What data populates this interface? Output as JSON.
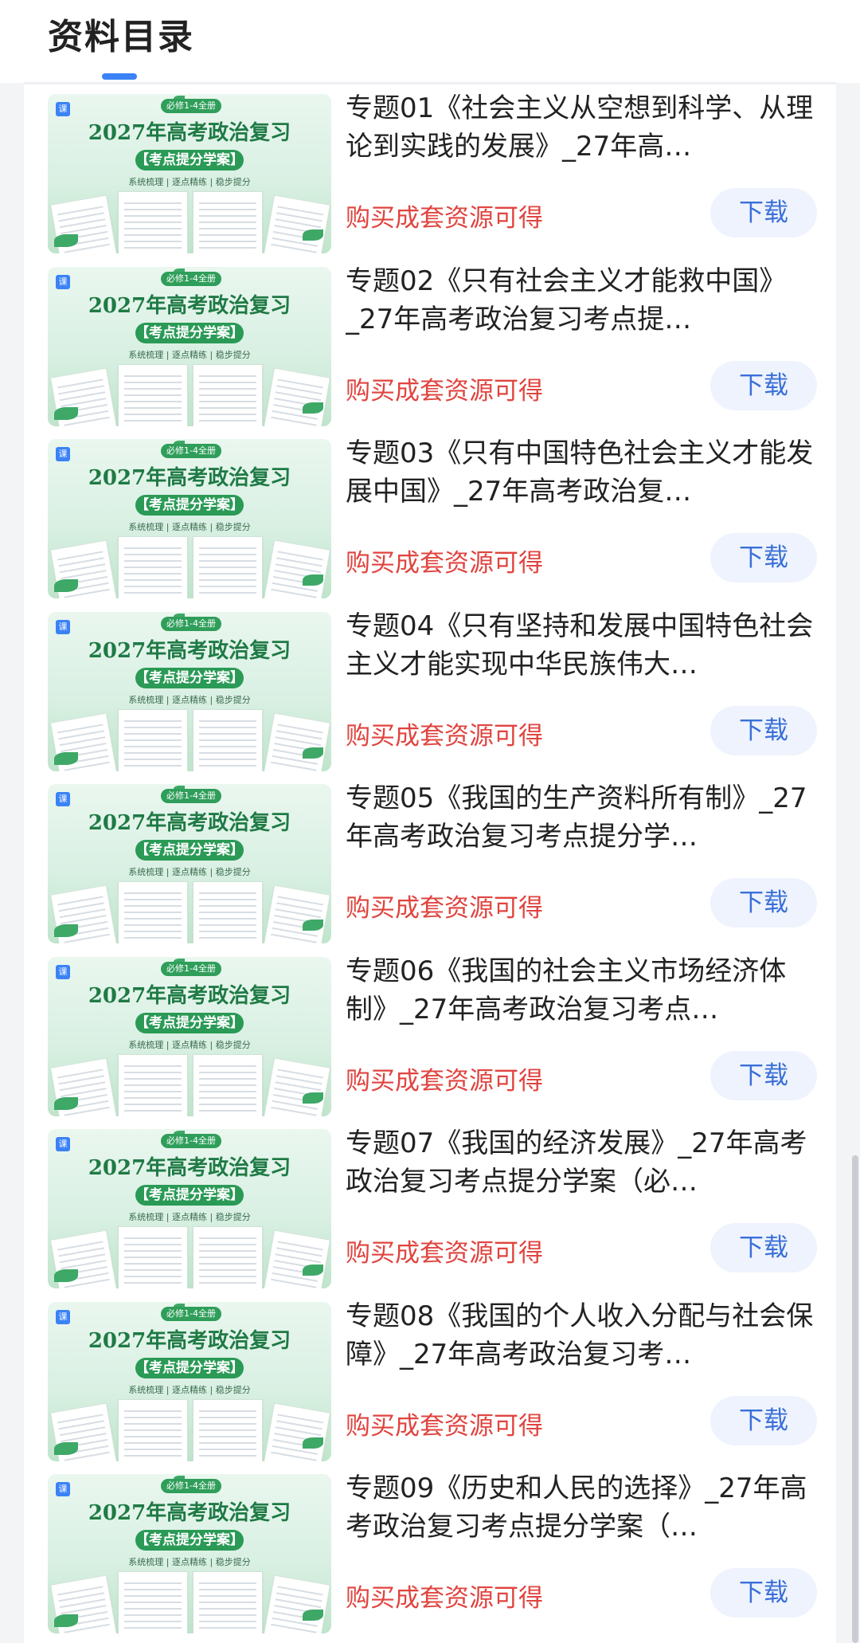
{
  "header": {
    "title": "资料目录"
  },
  "thumbnail": {
    "badge": "课",
    "pill": "必修1-4全册",
    "headline": "2027年高考政治复习",
    "banner": "【考点提分学案】",
    "subtitle": "系统梳理 | 逐点精练 | 稳步提分"
  },
  "items": [
    {
      "title": "专题01《社会主义从空想到科学、从理论到实践的发展》_27年高…",
      "note": "购买成套资源可得",
      "button": "下载"
    },
    {
      "title": "专题02《只有社会主义才能救中国》_27年高考政治复习考点提…",
      "note": "购买成套资源可得",
      "button": "下载"
    },
    {
      "title": "专题03《只有中国特色社会主义才能发展中国》_27年高考政治复…",
      "note": "购买成套资源可得",
      "button": "下载"
    },
    {
      "title": "专题04《只有坚持和发展中国特色社会主义才能实现中华民族伟大…",
      "note": "购买成套资源可得",
      "button": "下载"
    },
    {
      "title": "专题05《我国的生产资料所有制》_27年高考政治复习考点提分学…",
      "note": "购买成套资源可得",
      "button": "下载"
    },
    {
      "title": "专题06《我国的社会主义市场经济体制》_27年高考政治复习考点…",
      "note": "购买成套资源可得",
      "button": "下载"
    },
    {
      "title": "专题07《我国的经济发展》_27年高考政治复习考点提分学案（必…",
      "note": "购买成套资源可得",
      "button": "下载"
    },
    {
      "title": "专题08《我国的个人收入分配与社会保障》_27年高考政治复习考…",
      "note": "购买成套资源可得",
      "button": "下载"
    },
    {
      "title": "专题09《历史和人民的选择》_27年高考政治复习考点提分学案（…",
      "note": "购买成套资源可得",
      "button": "下载"
    }
  ]
}
